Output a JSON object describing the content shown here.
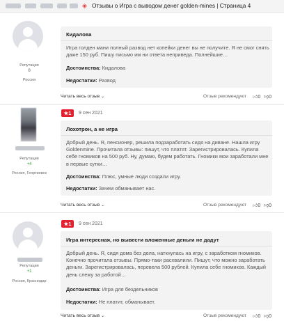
{
  "topbar": {
    "title": "Отзывы о Игра с выводом денег golden-mines | Страница 4",
    "pin_icon": "pin-icon"
  },
  "reviews": [
    {
      "title": "Кидалова",
      "text": "Игра голден мани полный развод нет копейки денег вы не получите. Я не смог снять даже 150 руб. Пишу письмо им ни ответа неприведа. Полнейшие…",
      "pros_label": "Достоинства:",
      "pros": "Кидалова",
      "cons_label": "Недостатки:",
      "cons": "Развод",
      "rep_label": "Репутация",
      "rep": "0",
      "location": "Россия",
      "read_all": "Читать весь отзыв",
      "recommend": "Отзыв рекомендуют",
      "likes": "0",
      "dislikes": "0"
    },
    {
      "rating": "1",
      "date": "9 сен 2021",
      "title": "Лохотрон, а не игра",
      "text": "Добрый день. Я, пенсионер, решила подзаработать сидя на диване. Нашла игру Goldenmine. Прочитала отзывы: пишут, что платят. Зарегистрировалась. Купила себе гномиков на 500 руб. Ну, думаю, будем работать. Гномики мои заработали мне в первые сутки…",
      "pros_label": "Достоинства:",
      "pros": "Плюс, умные люди создали игру.",
      "cons_label": "Недостатки:",
      "cons": "Зачем обманывает нас.",
      "rep_label": "Репутация",
      "rep": "+4",
      "location": "Россия, Георгиевск",
      "read_all": "Читать весь отзыв",
      "recommend": "Отзыв рекомендуют",
      "likes": "0",
      "dislikes": "0"
    },
    {
      "rating": "1",
      "date": "9 сен 2021",
      "title": "Игра интересная, но вывести вложенные деньги не дадут",
      "text": "Добрый день. Я, сидя дома без дела, наткнулась на игру, с заработком гномиков. Конечно прочитала отзывы. Прямо-таки расхвалили. Пишут, что можно заработать деньги. Зарегистрировалась, перевела 500 рублей. Купила себе гномиков. Каждый день слежу за работой…",
      "pros_label": "Достоинства:",
      "pros": "Игра для бездельников",
      "cons_label": "Недостатки:",
      "cons": "Не платит, обманывает.",
      "rep_label": "Репутация",
      "rep": "+1",
      "location": "Россия, Краснодар",
      "read_all": "Читать весь отзыв",
      "recommend": "Отзыв рекомендуют",
      "likes": "0",
      "dislikes": "0"
    }
  ]
}
